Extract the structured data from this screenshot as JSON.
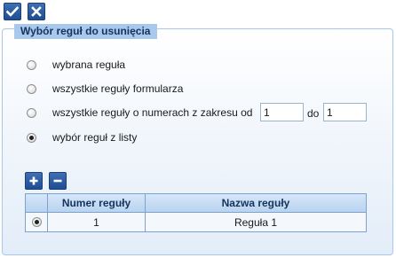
{
  "toolbar": {
    "confirm_icon": "checkmark-icon",
    "cancel_icon": "close-icon"
  },
  "panel": {
    "title": "Wybór reguł do usunięcia"
  },
  "options": {
    "selected_rule": "wybrana reguła",
    "all_rules": "wszystkie reguły formularza",
    "range_rules": "wszystkie reguły o numerach z zakresu od",
    "range_to": "do",
    "from_list": "wybór reguł z listy",
    "checked": "from_list"
  },
  "range": {
    "from_value": "1",
    "to_value": "1"
  },
  "list_controls": {
    "add_icon": "plus-icon",
    "remove_icon": "minus-icon"
  },
  "table": {
    "headers": {
      "select": "",
      "number": "Numer reguły",
      "name": "Nazwa reguły"
    },
    "rows": [
      {
        "selected": true,
        "number": "1",
        "name": "Reguła 1"
      }
    ]
  },
  "colors": {
    "accent": "#1f4c93",
    "panel_title_bg": "#a8c9ec",
    "border": "#7da2ce"
  }
}
